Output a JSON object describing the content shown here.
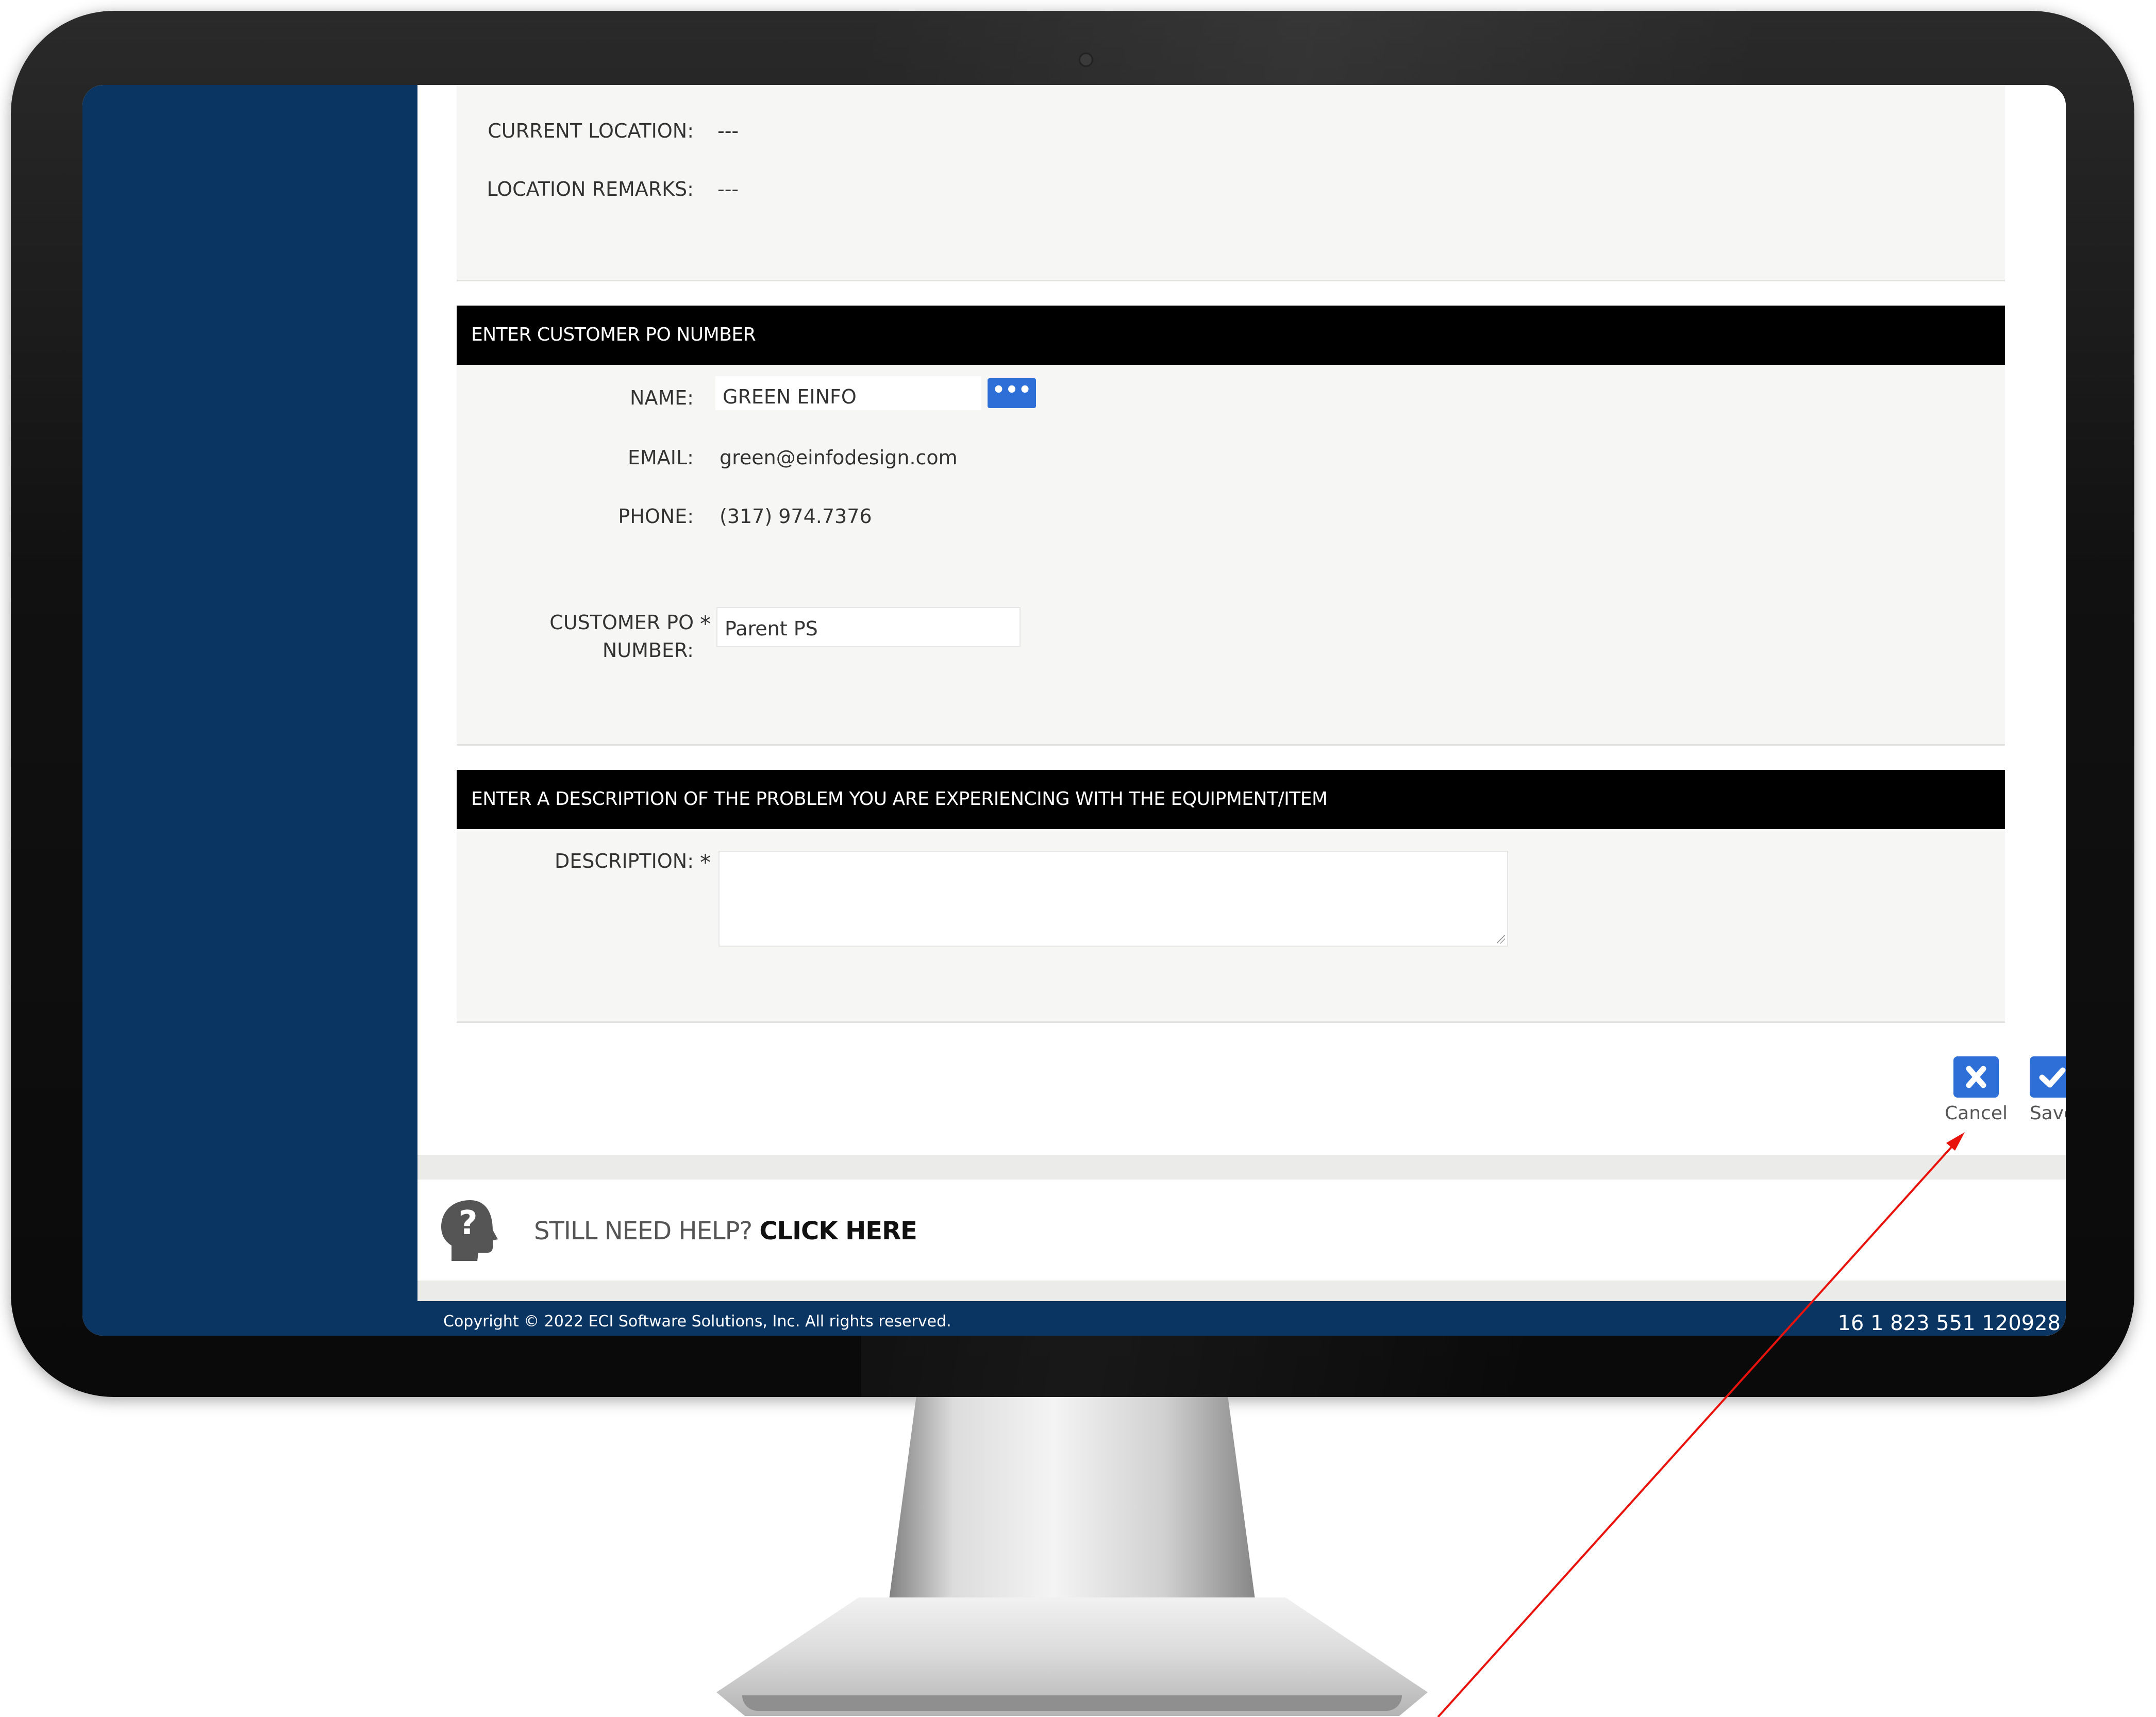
{
  "location_panel": {
    "current_location_label": "CURRENT LOCATION:",
    "current_location_value": "---",
    "location_remarks_label": "LOCATION REMARKS:",
    "location_remarks_value": "---"
  },
  "customer_po_section": {
    "header": "ENTER CUSTOMER PO NUMBER",
    "name_label": "NAME:",
    "name_value": "GREEN EINFO",
    "lookup_button_label": "•••",
    "email_label": "EMAIL:",
    "email_value": "green@einfodesign.com",
    "phone_label": "PHONE:",
    "phone_value": "(317) 974.7376",
    "po_label_line1": "CUSTOMER PO",
    "po_label_line2": "NUMBER:",
    "required_marker": "*",
    "po_value": "Parent PS"
  },
  "description_section": {
    "header": "ENTER A DESCRIPTION OF THE PROBLEM YOU ARE EXPERIENCING WITH THE EQUIPMENT/ITEM",
    "description_label": "DESCRIPTION:",
    "required_marker": "*",
    "description_value": ""
  },
  "actions": {
    "cancel_label": "Cancel",
    "save_label": "Save"
  },
  "help": {
    "text": "STILL NEED HELP?",
    "link": "CLICK HERE"
  },
  "footer": {
    "copyright": "Copyright © 2022 ECI Software Solutions, Inc. All rights reserved.",
    "phone": "16 1 823 551 120928"
  },
  "colors": {
    "sidebar": "#0a3461",
    "section_header": "#000000",
    "accent_button": "#2d6fd6",
    "annotation_arrow": "#e8130c"
  }
}
